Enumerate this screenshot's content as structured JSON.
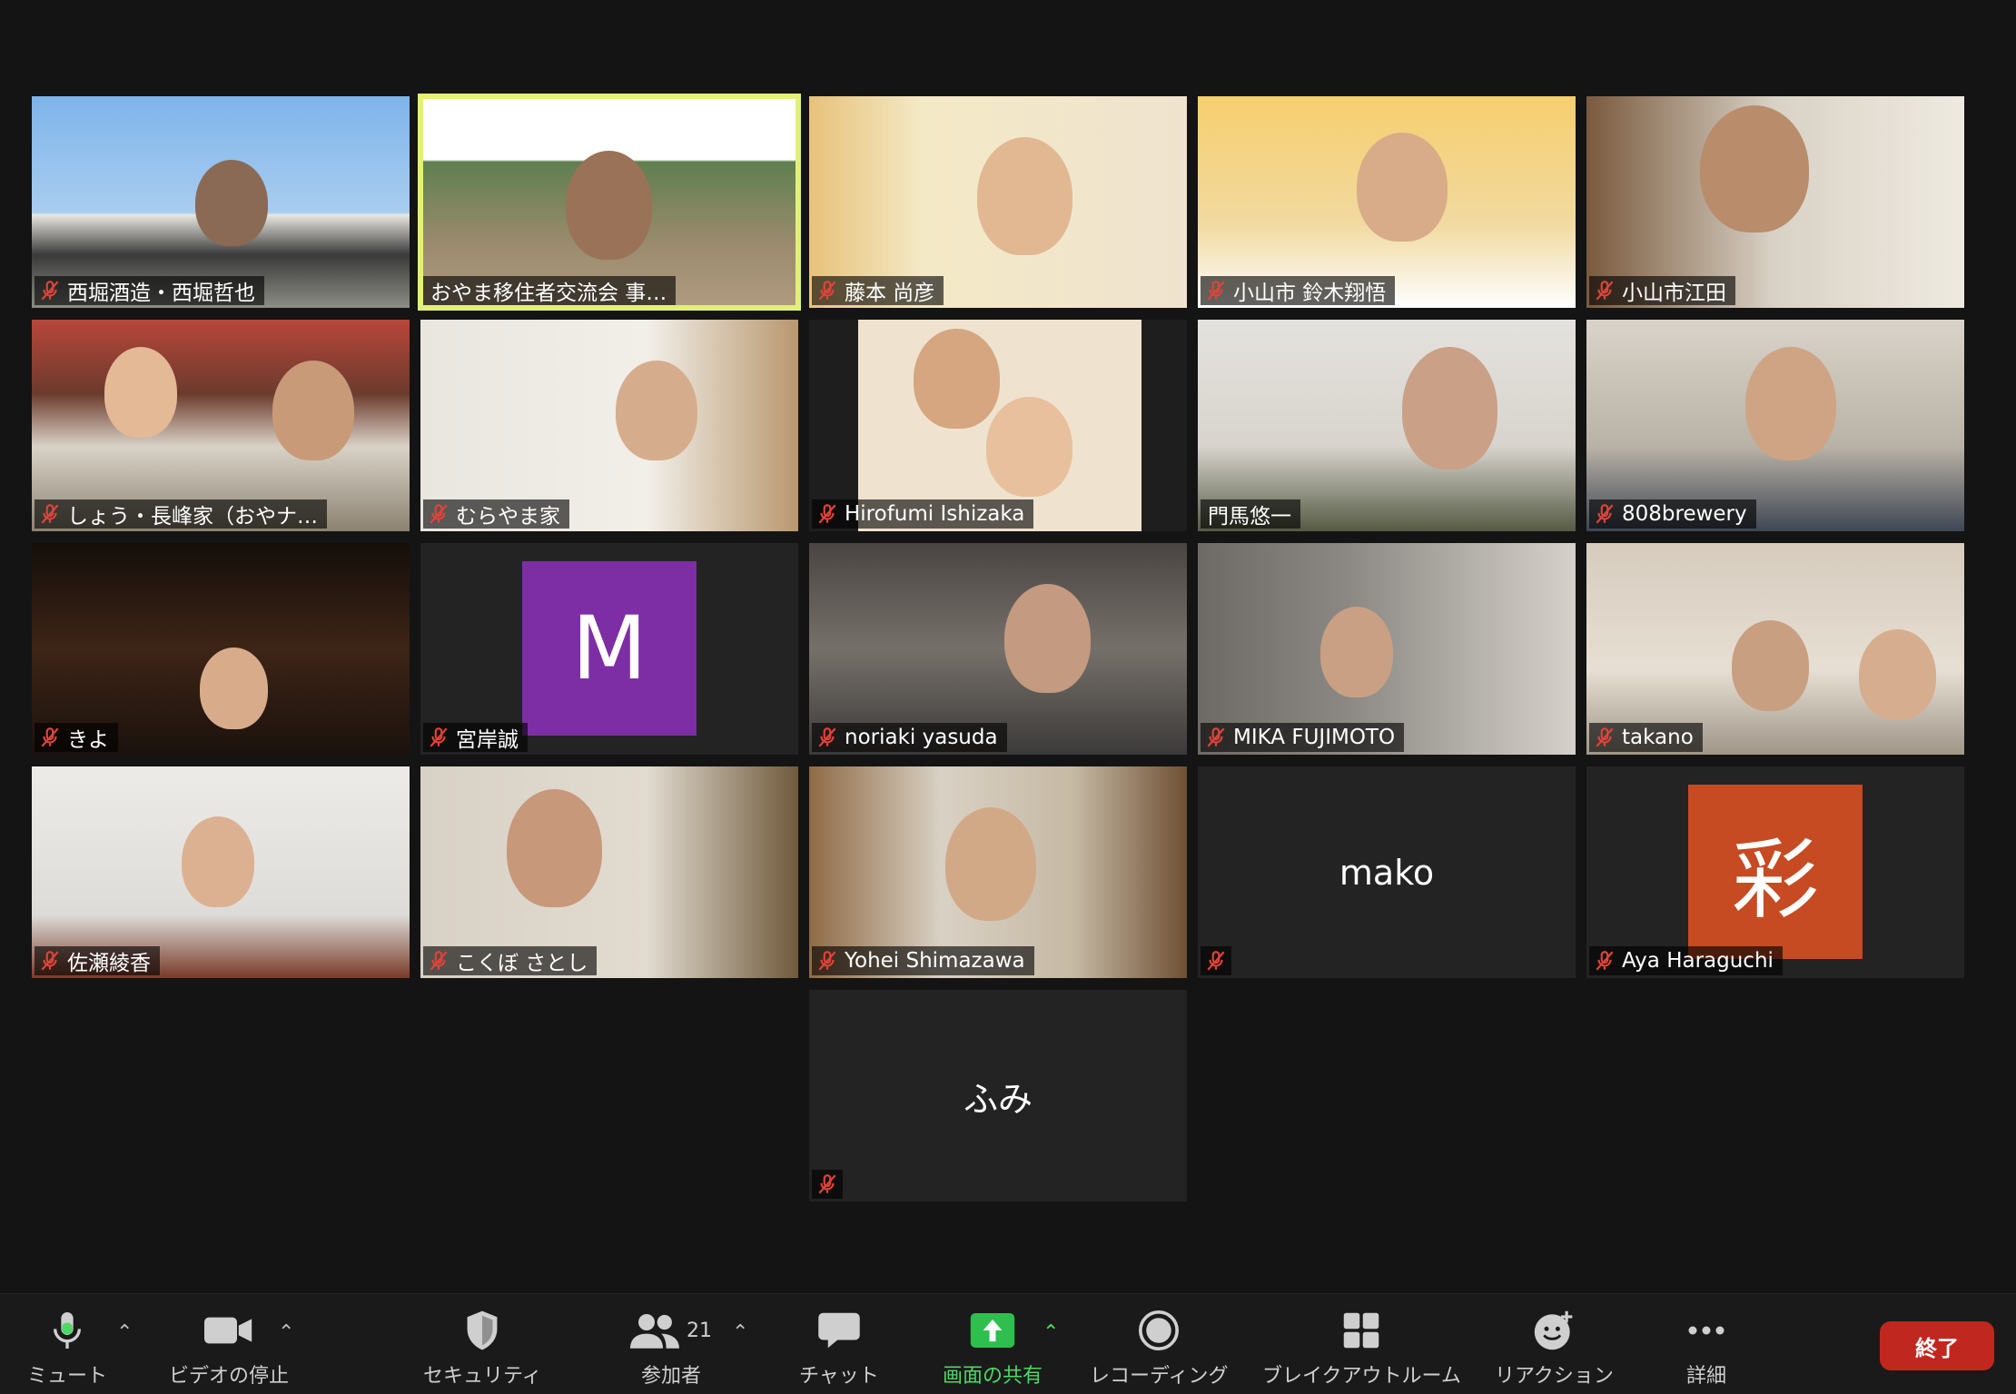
{
  "participants": [
    {
      "name": "西堀酒造・西堀哲也"
    },
    {
      "name": "おやま移住者交流会 事…"
    },
    {
      "name": "藤本 尚彦"
    },
    {
      "name": "小山市 鈴木翔悟"
    },
    {
      "name": "小山市江田"
    },
    {
      "name": "しょう・長峰家（おやナ…"
    },
    {
      "name": "むらやま家"
    },
    {
      "name": "Hirofumi Ishizaka"
    },
    {
      "name": "門馬悠一"
    },
    {
      "name": "808brewery"
    },
    {
      "name": "きよ"
    },
    {
      "name": "宮岸誠",
      "avatar_letter": "M",
      "avatar_color": "#7d2ea5"
    },
    {
      "name": "noriaki yasuda"
    },
    {
      "name": "MIKA FUJIMOTO"
    },
    {
      "name": "takano"
    },
    {
      "name": "佐瀬綾香"
    },
    {
      "name": "こくぼ さとし"
    },
    {
      "name": "Yohei Shimazawa"
    },
    {
      "name": "mako"
    },
    {
      "name": "Aya Haraguchi",
      "avatar_letter": "彩",
      "avatar_color": "#c64b22"
    },
    {
      "name": "ふみ"
    }
  ],
  "toolbar": {
    "mute_label": "ミュート",
    "video_label": "ビデオの停止",
    "security_label": "セキュリティ",
    "participants_label": "参加者",
    "participants_count": "21",
    "chat_label": "チャット",
    "share_label": "画面の共有",
    "record_label": "レコーディング",
    "breakout_label": "ブレイクアウトルーム",
    "reactions_label": "リアクション",
    "more_label": "詳細",
    "end_label": "終了"
  },
  "colors": {
    "active_speaker": "#e2f07a",
    "mute_red": "#e0433a",
    "share_green": "#2fbf4f",
    "end_red": "#c0271f"
  }
}
